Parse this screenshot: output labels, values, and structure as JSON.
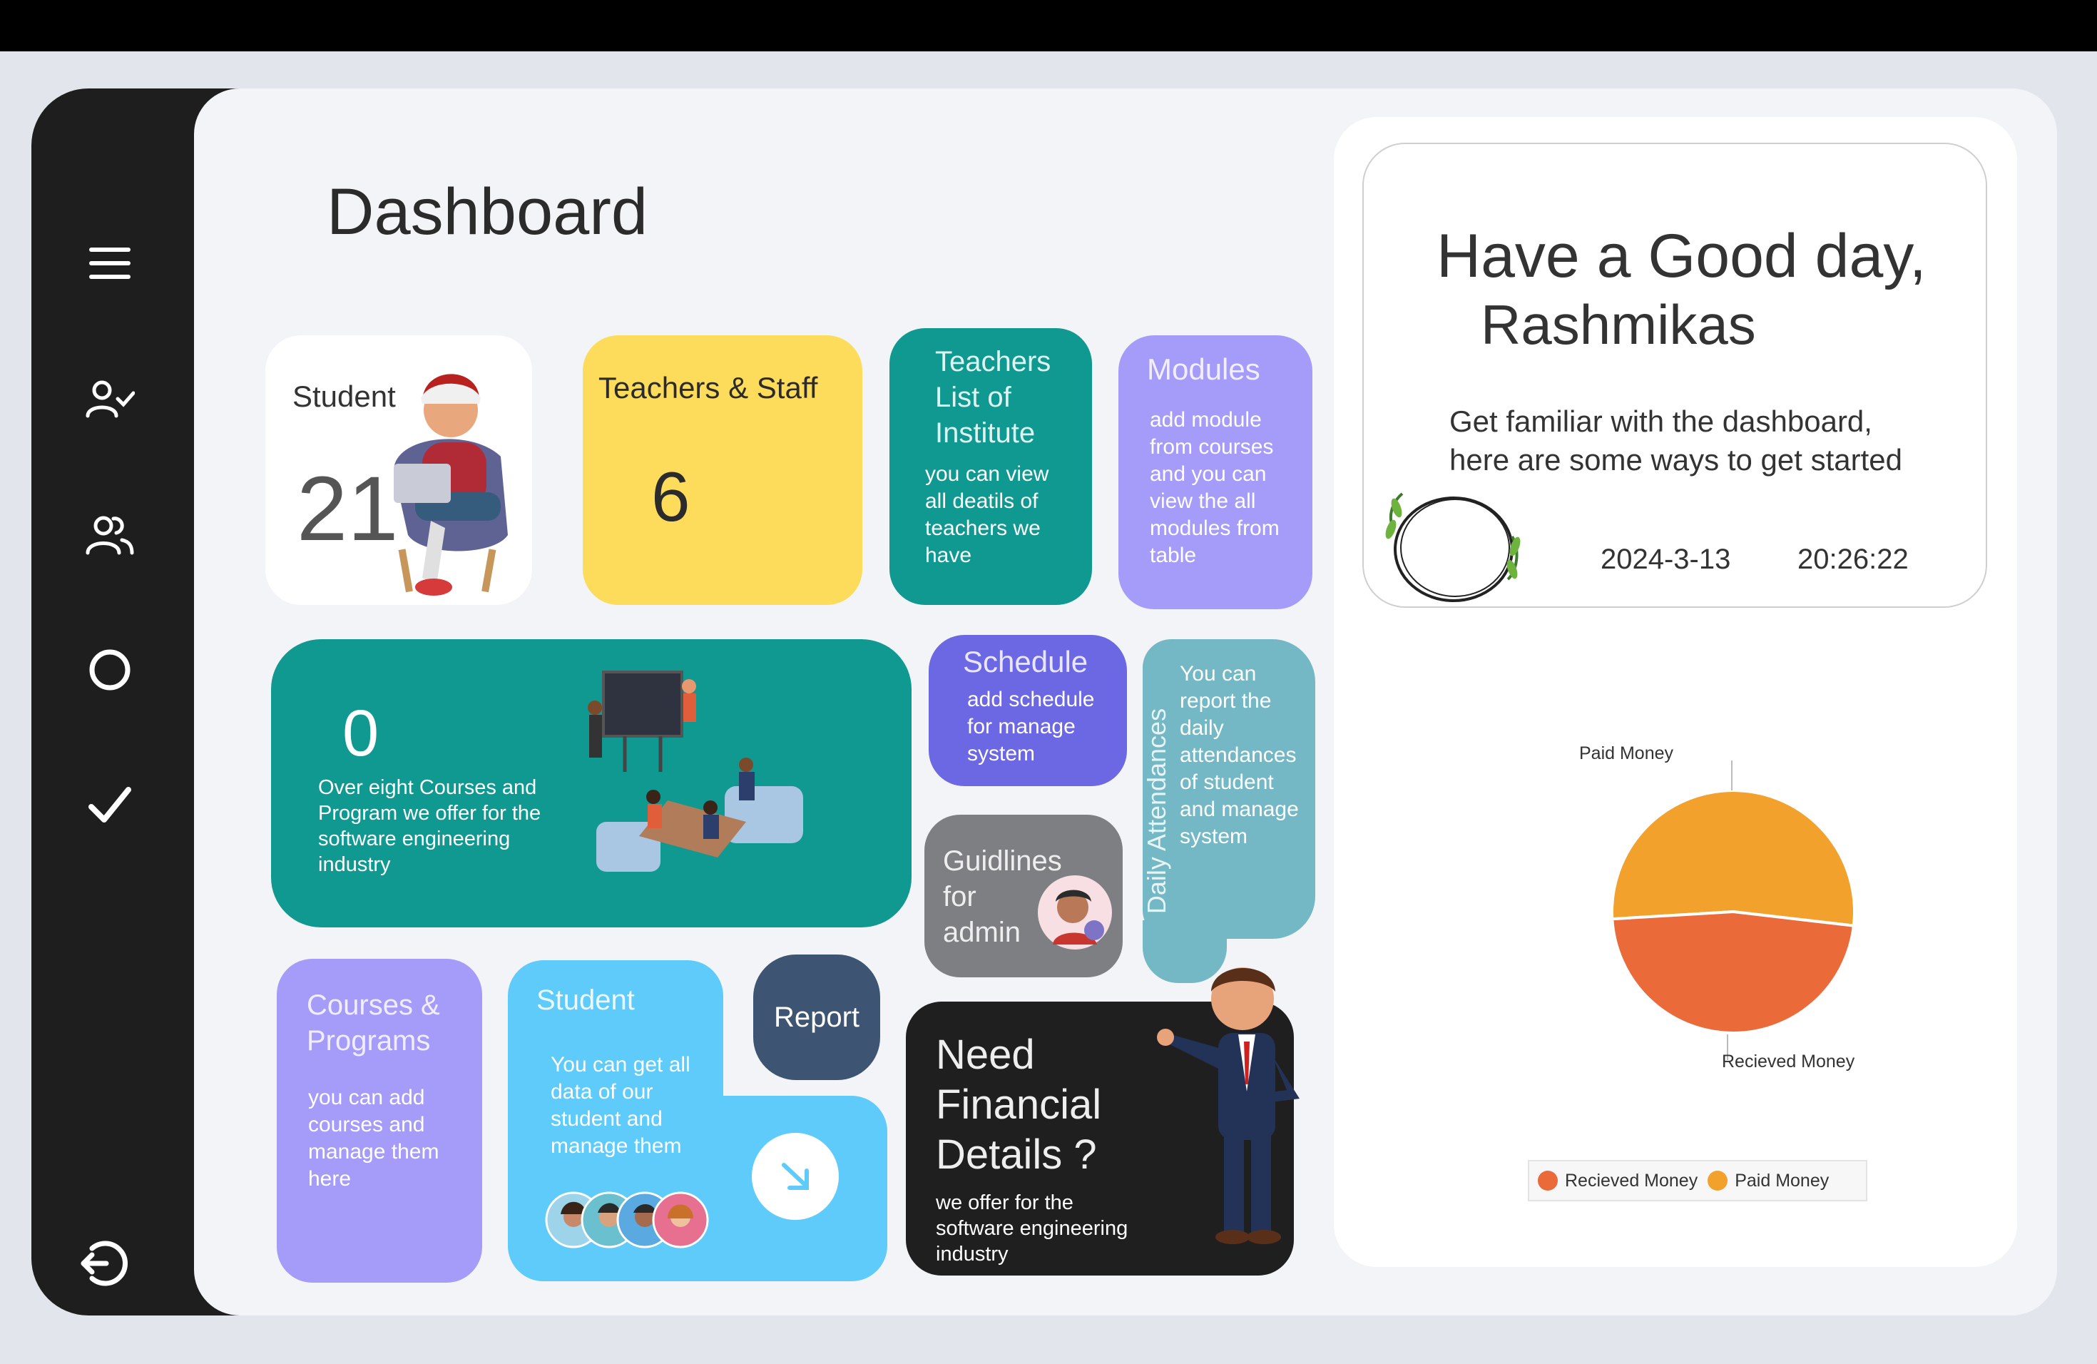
{
  "page_title": "Dashboard",
  "sidebar": {
    "items": [
      {
        "name": "menu-icon"
      },
      {
        "name": "user-check-icon"
      },
      {
        "name": "users-icon"
      },
      {
        "name": "circle-icon"
      },
      {
        "name": "check-icon"
      },
      {
        "name": "logout-icon"
      }
    ]
  },
  "cards": {
    "student": {
      "title": "Student",
      "count": "21"
    },
    "teachers_staff": {
      "title": "Teachers & Staff",
      "count": "6"
    },
    "teachers_list": {
      "title": "Teachers List of Institute",
      "desc": "you can view all deatils of teachers we have"
    },
    "modules": {
      "title": "Modules",
      "desc": "add module from courses and you can view the all modules from table"
    },
    "courses_offer": {
      "count": "0",
      "desc": "Over eight Courses and Program we offer for the software engineering industry"
    },
    "schedule": {
      "title": "Schedule",
      "desc": "add schedule for manage system"
    },
    "guidelines": {
      "title": "Guidlines for admin"
    },
    "attendance": {
      "title": "Daily Attendances",
      "desc": "You can report the daily attendances of student and manage system"
    },
    "courses_programs": {
      "title": "Courses & Programs",
      "desc": "you can add courses and manage them here"
    },
    "student_data": {
      "title": "Student",
      "desc": "You can get all data of our student and manage them"
    },
    "report": {
      "label": "Report"
    },
    "financial": {
      "title": "Need Financial Details ?",
      "desc": "we offer for the software engineering industry"
    }
  },
  "welcome": {
    "greeting_line1": "Have a Good day,",
    "greeting_line2": "Rashmikas",
    "subtitle": "Get familiar with the dashboard, here are some ways to get started",
    "date": "2024-3-13",
    "time": "20:26:22"
  },
  "colors": {
    "sidebar": "#1e1e1e",
    "teal": "#0f9990",
    "yellow": "#fddb5b",
    "lavender": "#a59cfa",
    "indigo": "#6c67e2",
    "gray": "#7d7f82",
    "steel": "#73b8c4",
    "sky": "#5ecbfb",
    "navy": "#3d5573",
    "dark": "#1f1f1f"
  },
  "chart_data": {
    "type": "pie",
    "series": [
      {
        "name": "Paid Money",
        "value": 52.8,
        "color": "#f2a12c"
      },
      {
        "name": "Recieved Money",
        "value": 47.2,
        "color": "#ea6a3a"
      }
    ],
    "labels": [
      "Paid Money",
      "Recieved Money"
    ],
    "legend": [
      "Recieved Money",
      "Paid Money"
    ],
    "legend_position": "bottom"
  }
}
